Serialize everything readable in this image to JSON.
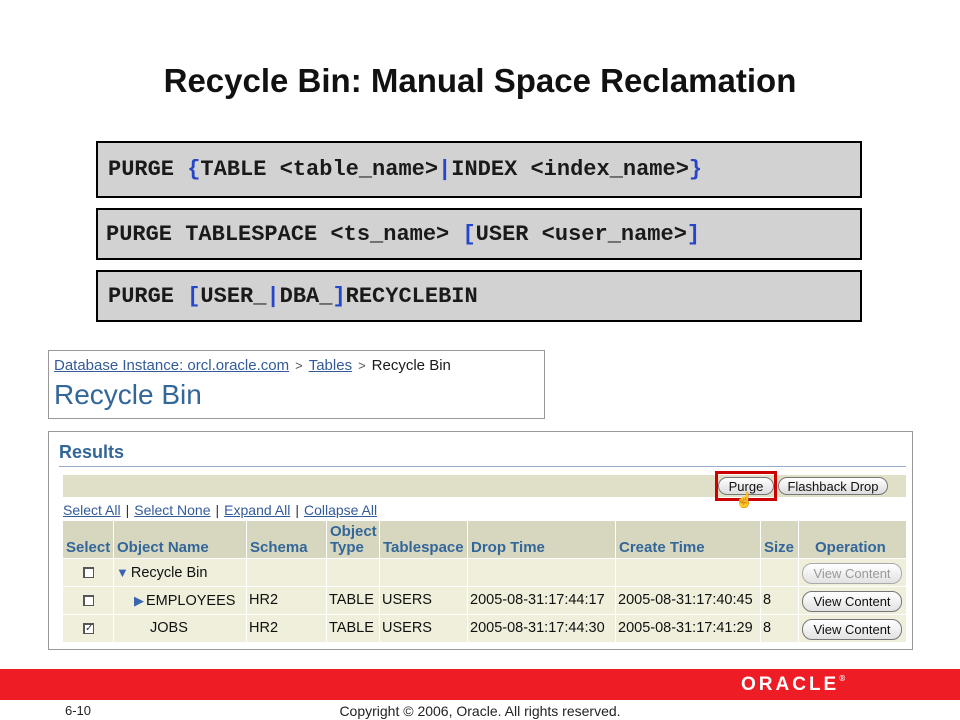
{
  "slide": {
    "title": "Recycle Bin: Manual Space Reclamation",
    "page_number": "6-10",
    "copyright": "Copyright © 2006, Oracle. All rights reserved.",
    "logo_text": "ORACLE",
    "logo_mark": "®"
  },
  "syntax": {
    "line1": {
      "p1": "PURGE ",
      "p2": "{",
      "p3": "TABLE <table_name>",
      "p4": "|",
      "p5": "INDEX <index_name>",
      "p6": "}"
    },
    "line2": {
      "p1": "PURGE TABLESPACE <ts_name> ",
      "p2": "[",
      "p3": "USER <user_name>",
      "p4": "]"
    },
    "line3": {
      "p1": "PURGE ",
      "p2": "[",
      "p3": "USER_",
      "p4": "|",
      "p5": "DBA_",
      "p6": "]",
      "p7": "RECYCLEBIN"
    }
  },
  "breadcrumb": {
    "items": [
      "Database Instance: orcl.oracle.com",
      "Tables",
      "Recycle Bin"
    ],
    "separator": ">"
  },
  "page_heading": "Recycle Bin",
  "results": {
    "heading": "Results",
    "buttons": {
      "purge": "Purge",
      "flashback": "Flashback Drop"
    },
    "links": [
      "Select All",
      "Select None",
      "Expand All",
      "Collapse All"
    ],
    "link_separator": "|",
    "columns": [
      "Select",
      "Object Name",
      "Schema",
      "Object\nType",
      "Tablespace",
      "Drop Time",
      "Create Time",
      "Size",
      "Operation"
    ],
    "rows": [
      {
        "checked": false,
        "name": "Recycle Bin",
        "expand": "▼",
        "schema": "",
        "type": "",
        "tablespace": "",
        "drop_time": "",
        "create_time": "",
        "size": "",
        "operation": "View Content",
        "op_enabled": false
      },
      {
        "checked": false,
        "name": "EMPLOYEES",
        "expand": "▶",
        "schema": "HR2",
        "type": "TABLE",
        "tablespace": "USERS",
        "drop_time": "2005-08-31:17:44:17",
        "create_time": "2005-08-31:17:40:45",
        "size": "8",
        "operation": "View Content",
        "op_enabled": true
      },
      {
        "checked": true,
        "name": "JOBS",
        "expand": "",
        "schema": "HR2",
        "type": "TABLE",
        "tablespace": "USERS",
        "drop_time": "2005-08-31:17:44:30",
        "create_time": "2005-08-31:17:41:29",
        "size": "8",
        "operation": "View Content",
        "op_enabled": true
      }
    ],
    "check_mark": "✓"
  },
  "colors": {
    "accent_red": "#ee1c24",
    "link_blue": "#335b9a",
    "heading_blue": "#336699",
    "syntax_blue": "#2546c9"
  }
}
